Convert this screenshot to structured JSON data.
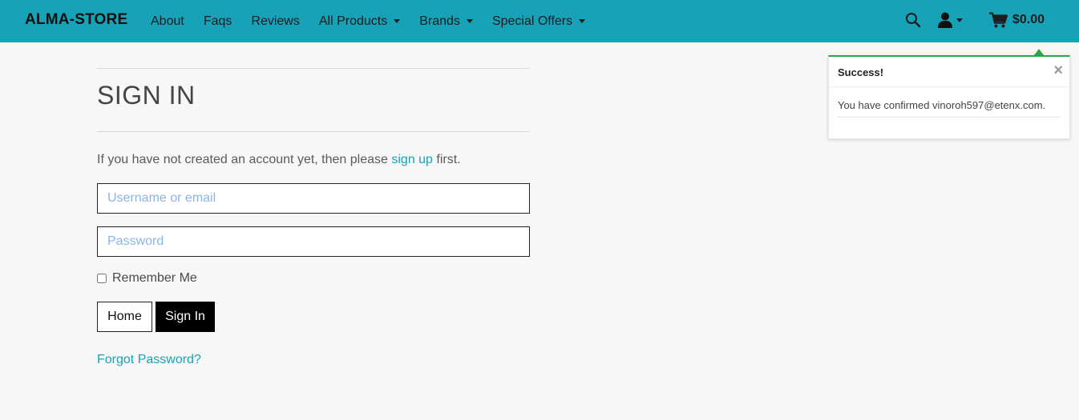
{
  "navbar": {
    "brand": "ALMA-STORE",
    "links": [
      {
        "label": "About"
      },
      {
        "label": "Faqs"
      },
      {
        "label": "Reviews"
      },
      {
        "label": "All Products"
      },
      {
        "label": "Brands"
      },
      {
        "label": "Special Offers"
      }
    ],
    "cart_total": "$0.00",
    "colors": {
      "background": "#17a2b8",
      "text": "#1c1c1c"
    }
  },
  "signin": {
    "title": "SIGN IN",
    "intro_before": "If you have not created an account yet, then please ",
    "intro_link": "sign up",
    "intro_after": " first.",
    "username_placeholder": "Username or email",
    "username_value": "",
    "password_placeholder": "Password",
    "password_value": "",
    "remember_label": "Remember Me",
    "remember_checked": false,
    "home_button": "Home",
    "signin_button": "Sign In",
    "forgot_link": "Forgot Password?"
  },
  "toast": {
    "title": "Success!",
    "message": "You have confirmed vinoroh597@etenx.com.",
    "close_symbol": "×",
    "accent": "#28a745"
  },
  "icons": {
    "search": "search-icon",
    "user": "user-icon",
    "cart": "cart-icon"
  }
}
